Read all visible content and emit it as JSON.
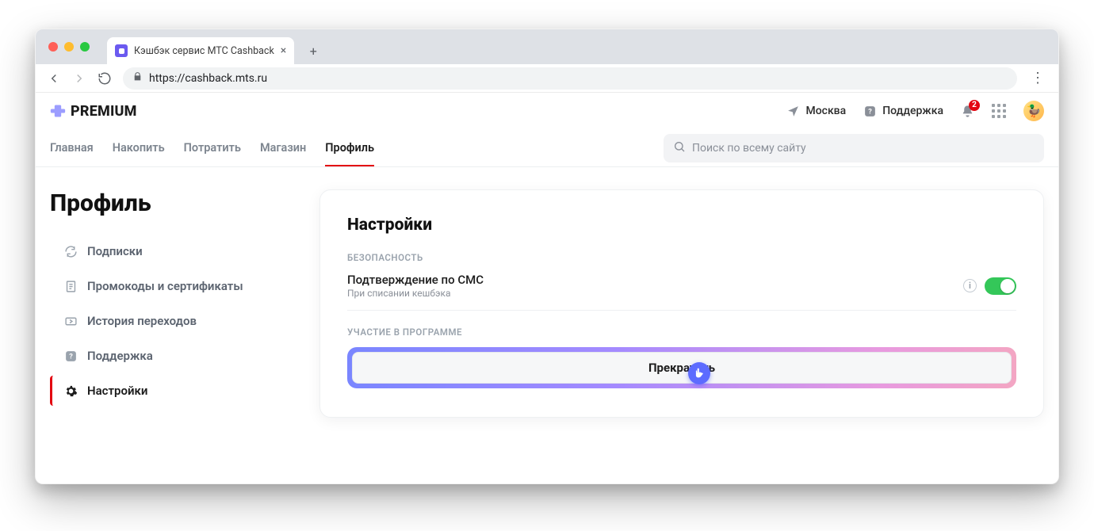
{
  "browser": {
    "tab_title": "Кэшбэк сервис МТС Cashback",
    "url": "https://cashback.mts.ru"
  },
  "header": {
    "logo_text": "PREMIUM",
    "location": "Москва",
    "support": "Поддержка",
    "notification_count": "2"
  },
  "nav": {
    "items": [
      "Главная",
      "Накопить",
      "Потратить",
      "Магазин",
      "Профиль"
    ],
    "active_index": 4,
    "search_placeholder": "Поиск по всему сайту"
  },
  "page_title": "Профиль",
  "sidebar": {
    "items": [
      {
        "label": "Подписки"
      },
      {
        "label": "Промокоды и сертификаты"
      },
      {
        "label": "История переходов"
      },
      {
        "label": "Поддержка"
      },
      {
        "label": "Настройки"
      }
    ],
    "active_index": 4
  },
  "settings": {
    "card_title": "Настройки",
    "section_security": "Безопасность",
    "sms_title": "Подтверждение по СМС",
    "sms_subtitle": "При списании кешбэка",
    "sms_toggle_on": true,
    "section_program": "Участие в программе",
    "stop_button": "Прекратить"
  }
}
